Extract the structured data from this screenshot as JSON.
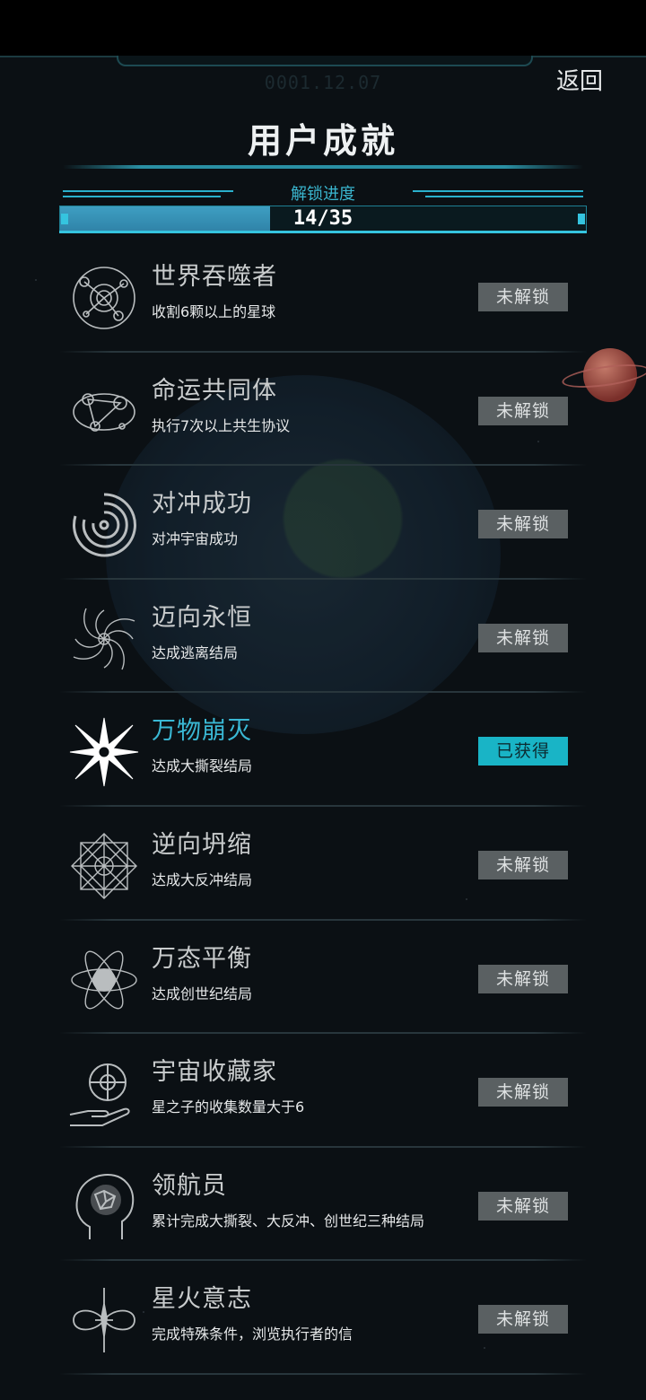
{
  "header": {
    "date": "0001.12.07",
    "back_label": "返回",
    "title": "用户成就"
  },
  "progress": {
    "label": "解锁进度",
    "text": "14/35",
    "unlocked": 14,
    "total": 35,
    "fraction": 0.4
  },
  "achievements": [
    {
      "name": "世界吞噬者",
      "desc": "收割6颗以上的星球",
      "status": "未解锁",
      "unlocked": false,
      "icon": "orbit-system-icon"
    },
    {
      "name": "命运共同体",
      "desc": "执行7次以上共生协议",
      "status": "未解锁",
      "unlocked": false,
      "icon": "planets-link-icon"
    },
    {
      "name": "对冲成功",
      "desc": "对冲宇宙成功",
      "status": "未解锁",
      "unlocked": false,
      "icon": "swirl-icon"
    },
    {
      "name": "迈向永恒",
      "desc": "达成逃离结局",
      "status": "未解锁",
      "unlocked": false,
      "icon": "vortex-icon"
    },
    {
      "name": "万物崩灭",
      "desc": "达成大撕裂结局",
      "status": "已获得",
      "unlocked": true,
      "icon": "starburst-icon"
    },
    {
      "name": "逆向坍缩",
      "desc": "达成大反冲结局",
      "status": "未解锁",
      "unlocked": false,
      "icon": "mandala-icon"
    },
    {
      "name": "万态平衡",
      "desc": "达成创世纪结局",
      "status": "未解锁",
      "unlocked": false,
      "icon": "atom-icon"
    },
    {
      "name": "宇宙收藏家",
      "desc": "星之子的收集数量大于6",
      "status": "未解锁",
      "unlocked": false,
      "icon": "hand-sphere-icon"
    },
    {
      "name": "领航员",
      "desc": "累计完成大撕裂、大反冲、创世纪三种结局",
      "status": "未解锁",
      "unlocked": false,
      "icon": "brain-head-icon"
    },
    {
      "name": "星火意志",
      "desc": "完成特殊条件，浏览执行者的信",
      "status": "未解锁",
      "unlocked": false,
      "icon": "infinity-star-icon"
    }
  ]
}
